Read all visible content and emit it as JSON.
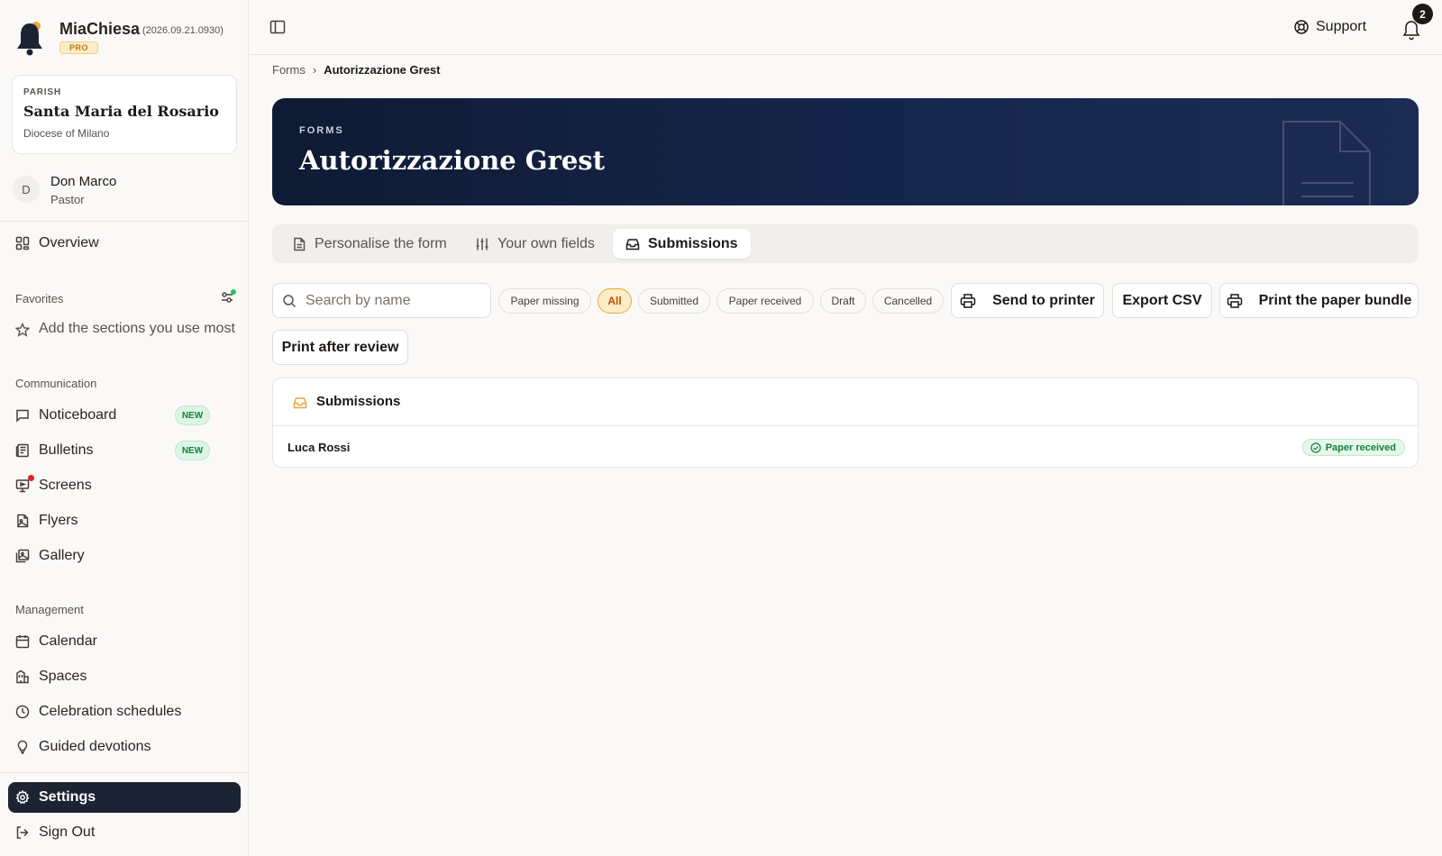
{
  "brand": {
    "name": "MiaChiesa",
    "version": "(2026.09.21.0930)",
    "tier": "PRO"
  },
  "parish": {
    "kicker": "PARISH",
    "name": "Santa Maria del Rosario",
    "diocese": "Diocese of Milano"
  },
  "user": {
    "initial": "D",
    "name": "Don Marco",
    "role": "Pastor"
  },
  "sidebar": {
    "overview": "Overview",
    "favorites_label": "Favorites",
    "favorites_placeholder": "Add the sections you use most",
    "communication_label": "Communication",
    "communication": [
      {
        "label": "Noticeboard",
        "badge": "NEW"
      },
      {
        "label": "Bulletins",
        "badge": "NEW"
      },
      {
        "label": "Screens"
      },
      {
        "label": "Flyers"
      },
      {
        "label": "Gallery"
      }
    ],
    "management_label": "Management",
    "management": [
      {
        "label": "Calendar"
      },
      {
        "label": "Spaces"
      },
      {
        "label": "Celebration schedules"
      },
      {
        "label": "Guided devotions"
      }
    ],
    "settings": "Settings",
    "sign_out": "Sign Out"
  },
  "topbar": {
    "support": "Support",
    "notification_count": "2"
  },
  "breadcrumb": {
    "parent": "Forms",
    "separator": "›",
    "current": "Autorizzazione Grest"
  },
  "hero": {
    "kicker": "FORMS",
    "title": "Autorizzazione Grest"
  },
  "tabs": [
    {
      "label": "Personalise the form",
      "icon": "document-icon"
    },
    {
      "label": "Your own fields",
      "icon": "sliders-icon"
    },
    {
      "label": "Submissions",
      "icon": "inbox-icon",
      "active": true
    }
  ],
  "toolbar": {
    "search_placeholder": "Search by name",
    "filters": [
      "Paper missing",
      "All",
      "Submitted",
      "Paper received",
      "Draft",
      "Cancelled"
    ],
    "active_filter": "All",
    "send_to_printer": "Send to printer",
    "export_csv": "Export CSV",
    "print_bundle": "Print the paper bundle",
    "print_after_review": "Print after review"
  },
  "submissions": {
    "title": "Submissions",
    "rows": [
      {
        "name": "Luca Rossi",
        "status": "Paper received"
      }
    ]
  },
  "colors": {
    "accent_navy": "#1c2333",
    "hero_navy": "#0f1a33",
    "amber": "#e9a740",
    "success": "#15803d"
  }
}
